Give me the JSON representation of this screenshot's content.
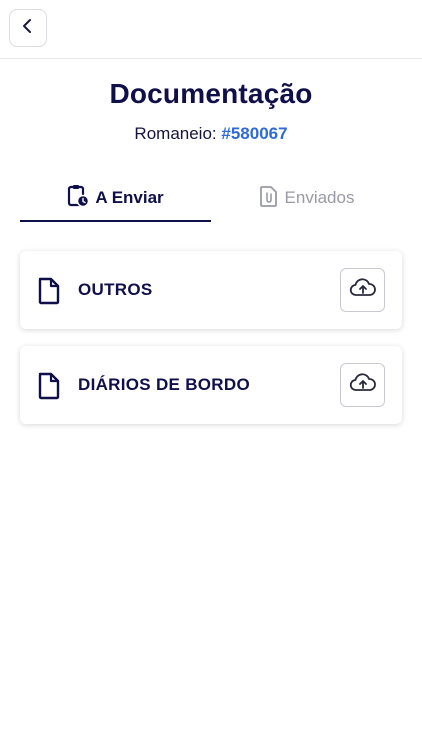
{
  "header": {
    "back_icon": "chevron-left-icon"
  },
  "page": {
    "title": "Documentação",
    "subtitle_label": "Romaneio:",
    "subtitle_number": "#580067"
  },
  "tabs": [
    {
      "label": "A Enviar",
      "icon": "clipboard-clock-icon",
      "active": true
    },
    {
      "label": "Enviados",
      "icon": "file-attachment-icon",
      "active": false
    }
  ],
  "documents": [
    {
      "label": "OUTROS",
      "icon": "file-icon",
      "action_icon": "cloud-upload-icon"
    },
    {
      "label": "DIÁRIOS DE BORDO",
      "icon": "file-icon",
      "action_icon": "cloud-upload-icon"
    }
  ],
  "colors": {
    "primary": "#0f0f4a",
    "accent": "#2f6ad6",
    "muted": "#9a9aa6"
  }
}
